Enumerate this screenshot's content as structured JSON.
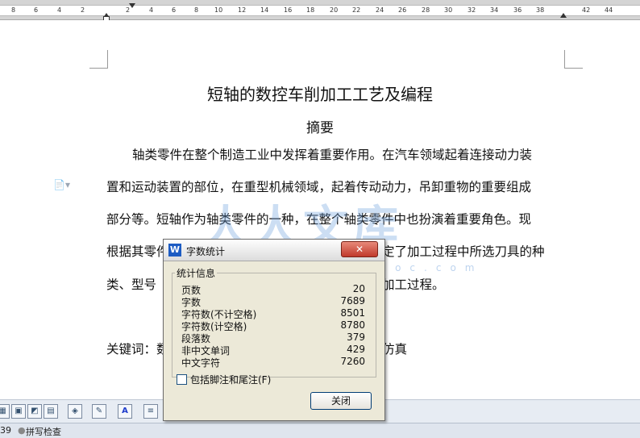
{
  "ruler": {
    "ticks": [
      "8",
      "6",
      "4",
      "2",
      "2",
      "4",
      "6",
      "8",
      "10",
      "12",
      "14",
      "16",
      "18",
      "20",
      "22",
      "24",
      "26",
      "28",
      "30",
      "32",
      "34",
      "36",
      "38",
      "42",
      "44"
    ]
  },
  "document": {
    "title": "短轴的数控车削加工工艺及编程",
    "subtitle": "摘要",
    "lines": [
      "轴类零件在整个制造工业中发挥着重要作用。在汽车领域起着连接动力装",
      "置和运动装置的部位，在重型机械领域，起着传动动力，吊卸重物的重要组成",
      "部分等。短轴作为轴类零件的一种，在整个轴类零件中也扮演着重要角色。现",
      "根据其零件",
      "类、型号",
      "关键词：数"
    ],
    "line_tail_4": "定了加工过程中所选刀具的种",
    "line_tail_5": "加工过程。",
    "line_tail_6": "仿真"
  },
  "watermark": {
    "text": "人人文库",
    "sub": "www.renrendoc.com"
  },
  "dialog": {
    "title": "字数统计",
    "close_glyph": "✕",
    "group_label": "统计信息",
    "stats": [
      {
        "label": "页数",
        "value": "20"
      },
      {
        "label": "字数",
        "value": "7689"
      },
      {
        "label": "字符数(不计空格)",
        "value": "8501"
      },
      {
        "label": "字符数(计空格)",
        "value": "8780"
      },
      {
        "label": "段落数",
        "value": "379"
      },
      {
        "label": "非中文单词",
        "value": "429"
      },
      {
        "label": "中文字符",
        "value": "7260"
      }
    ],
    "checkbox_label": "包括脚注和尾注(F)",
    "checkbox_checked": false,
    "button_label": "关闭",
    "logo_letter": "W"
  },
  "status": {
    "page_num": "39",
    "spellcheck": "拼写检查"
  },
  "colors": {
    "accent": "#1d5cc3",
    "close_red": "#c0392b"
  }
}
